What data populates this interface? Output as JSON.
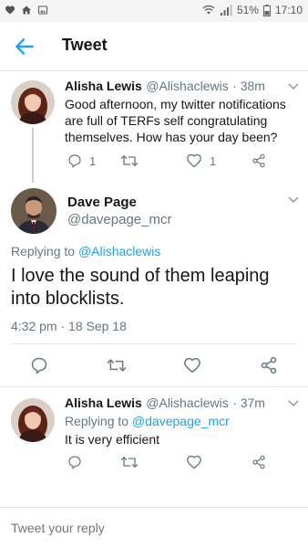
{
  "status_bar": {
    "battery": "51%",
    "time": "17:10"
  },
  "header": {
    "title": "Tweet"
  },
  "tweets": [
    {
      "name": "Alisha Lewis",
      "handle": "@Alishaclewis",
      "time": "· 38m",
      "text": "Good afternoon, my twitter notifications are full of TERFs self congratulating themselves. How has your day been?",
      "replies": "1",
      "likes": "1"
    },
    {
      "name": "Dave Page",
      "handle": "@davepage_mcr",
      "replying_prefix": "Replying to ",
      "replying_to": "@Alishaclewis",
      "text": "I love the sound of them leaping into blocklists.",
      "timestamp": "4:32 pm · 18 Sep 18"
    },
    {
      "name": "Alisha Lewis",
      "handle": "@Alishaclewis",
      "time": "· 37m",
      "replying_prefix": "Replying to ",
      "replying_to": "@davepage_mcr",
      "text": "It is very efficient"
    }
  ],
  "reply_box": {
    "placeholder": "Tweet your reply"
  },
  "colors": {
    "accent": "#1da1f2",
    "secondary_text": "#657786",
    "divider": "#e1e8ed"
  }
}
